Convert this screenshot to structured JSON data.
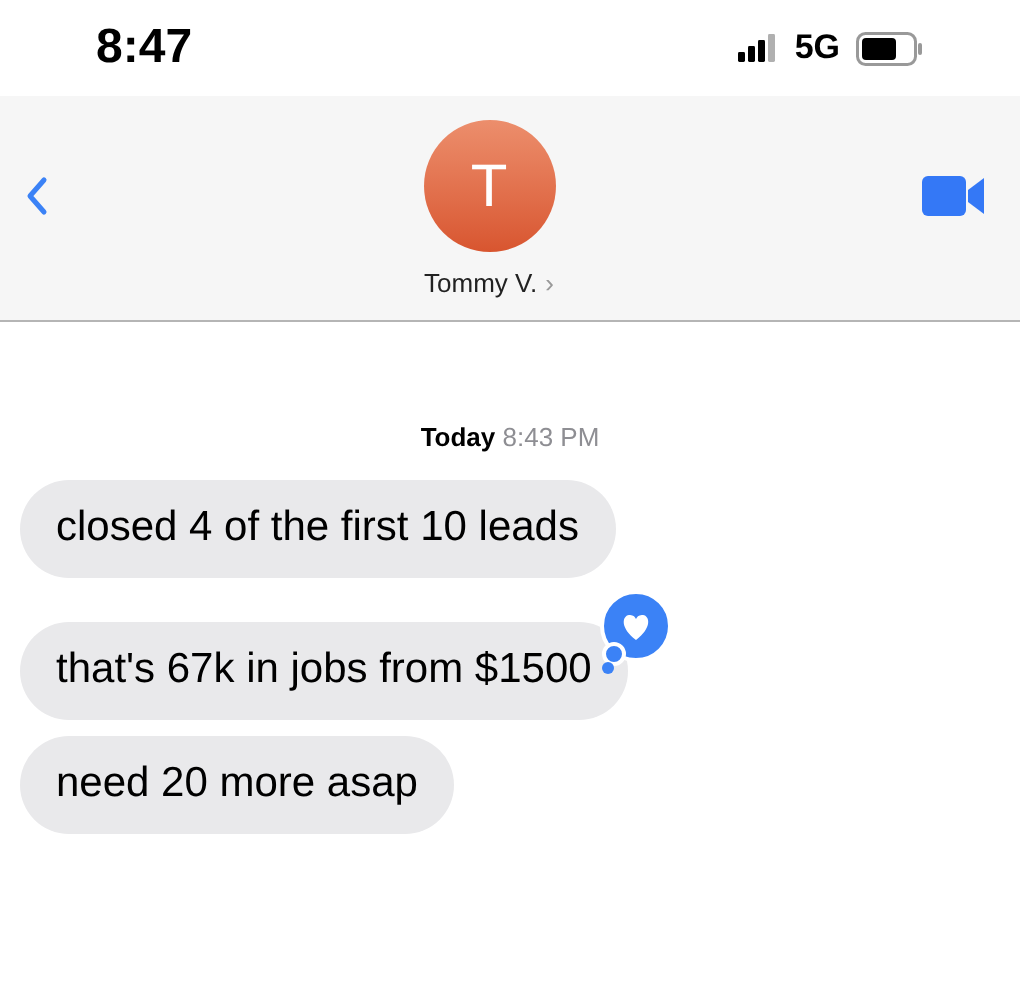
{
  "status_bar": {
    "time": "8:47",
    "network": "5G"
  },
  "header": {
    "avatar_initial": "T",
    "contact_name": "Tommy V.",
    "chevron": "›"
  },
  "timestamp": {
    "day": "Today",
    "time": "8:43 PM"
  },
  "messages": [
    {
      "text": "closed 4 of the first 10 leads",
      "tapback": false
    },
    {
      "text": "that's 67k in jobs from $1500",
      "tapback": true
    },
    {
      "text": "need 20 more asap",
      "tapback": false
    }
  ]
}
